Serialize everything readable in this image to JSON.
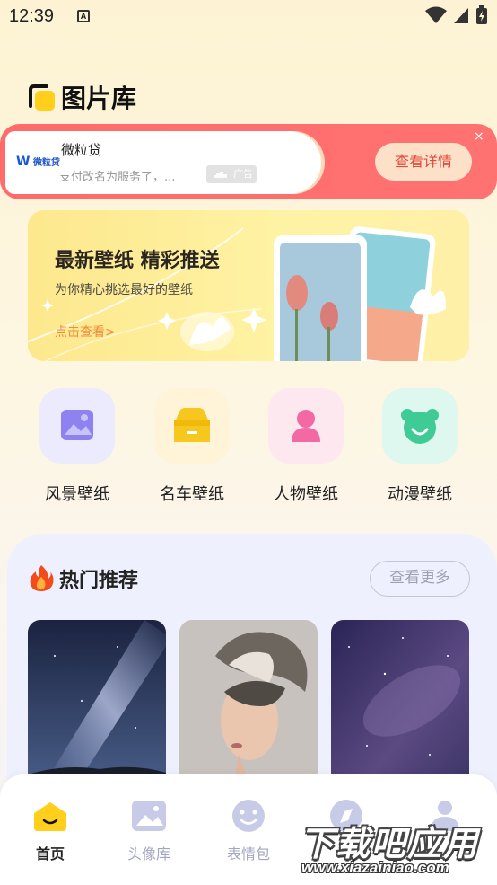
{
  "status_bar": {
    "time": "12:39",
    "notif_letter": "A"
  },
  "header": {
    "title": "图片库"
  },
  "ad": {
    "logo_text": "微粒贷",
    "name": "微粒贷",
    "desc": "支付改名为服务了，...",
    "tag": "广告",
    "cta": "查看详情",
    "close": "×"
  },
  "promo": {
    "title": "最新壁纸 精彩推送",
    "subtitle": "为你精心挑选最好的壁纸",
    "link": "点击查看>"
  },
  "categories": [
    {
      "label": "风景壁纸",
      "icon": "landscape-icon",
      "bg": "#ecebfd",
      "fg": "#8d82f0"
    },
    {
      "label": "名车壁纸",
      "icon": "car-icon",
      "bg": "#fff4d8",
      "fg": "#f6c81f"
    },
    {
      "label": "人物壁纸",
      "icon": "person-icon",
      "bg": "#fde8f0",
      "fg": "#f269a3"
    },
    {
      "label": "动漫壁纸",
      "icon": "bear-icon",
      "bg": "#def7ef",
      "fg": "#3ecb96"
    }
  ],
  "hot": {
    "title": "热门推荐",
    "more": "查看更多"
  },
  "nav": {
    "items": [
      {
        "label": "首页",
        "active": true
      },
      {
        "label": "头像库",
        "active": false
      },
      {
        "label": "表情包",
        "active": false
      }
    ]
  },
  "watermark": {
    "main": "下载吧应用",
    "url": "www.xiazainiao.com"
  },
  "colors": {
    "accent": "#ffcf1b",
    "ad_red": "#ff6a6a",
    "inactive": "#a3a6c0"
  }
}
